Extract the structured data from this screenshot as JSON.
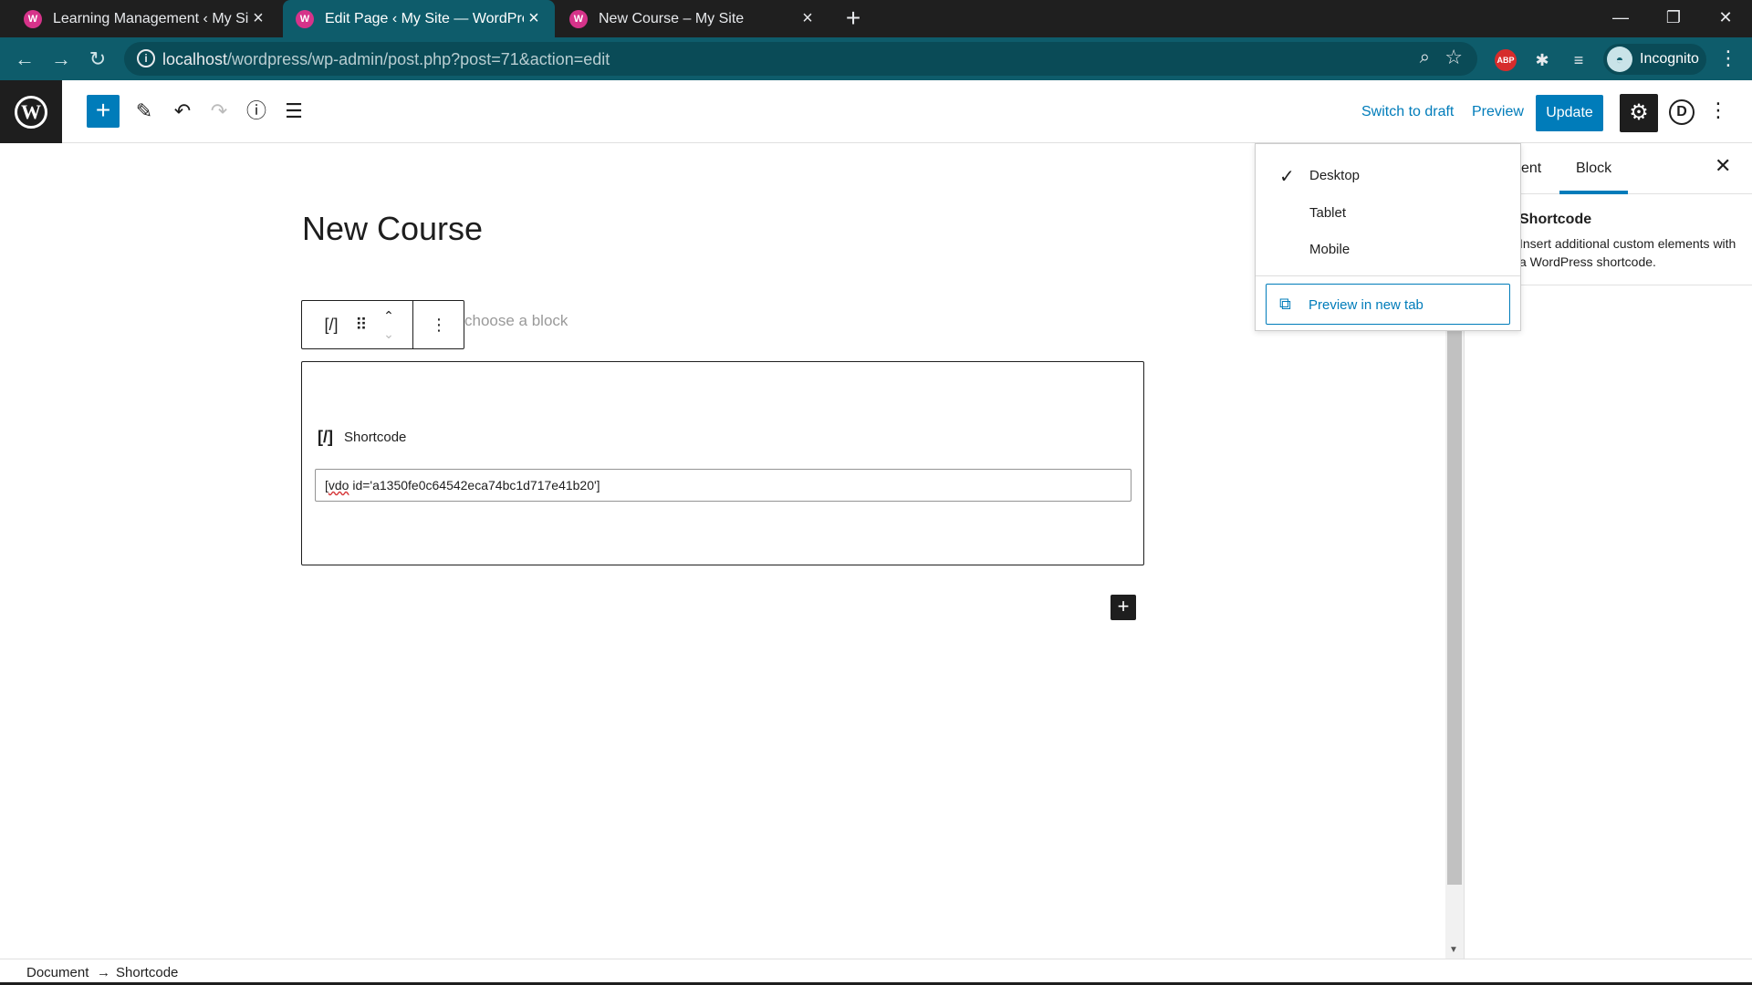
{
  "browser": {
    "tabs": [
      {
        "title": "Learning Management ‹ My Site",
        "active": false
      },
      {
        "title": "Edit Page ‹ My Site — WordPress",
        "active": true
      },
      {
        "title": "New Course – My Site",
        "active": false
      }
    ],
    "new_tab_label": "+",
    "url_host": "localhost",
    "url_path": "/wordpress/wp-admin/post.php?post=71&action=edit",
    "profile_label": "Incognito",
    "abp_label": "ABP"
  },
  "editor": {
    "switch_to_draft": "Switch to draft",
    "preview": "Preview",
    "update": "Update",
    "avatar_letter": "D",
    "page_title": "New Course",
    "block_icon": "[/]",
    "placeholder": "choose a block",
    "shortcode_label": "Shortcode",
    "shortcode_value_prefix": "[",
    "shortcode_value_spell": "vdo",
    "shortcode_value_rest": " id='a1350fe0c64542eca74bc1d717e41b20']"
  },
  "preview_menu": {
    "items": [
      {
        "label": "Desktop",
        "checked": true
      },
      {
        "label": "Tablet",
        "checked": false
      },
      {
        "label": "Mobile",
        "checked": false
      }
    ],
    "new_tab_button": "Preview in new tab"
  },
  "sidebar": {
    "tab_partial": "ent",
    "tab_block": "Block",
    "block_title": "Shortcode",
    "block_desc": "Insert additional custom elements with a WordPress shortcode."
  },
  "breadcrumb": {
    "items": [
      "Document",
      "Shortcode"
    ],
    "separator": "→"
  },
  "colors": {
    "accent": "#007cba",
    "browser_teal": "#0e5c6b",
    "dark": "#1e1e1e"
  }
}
